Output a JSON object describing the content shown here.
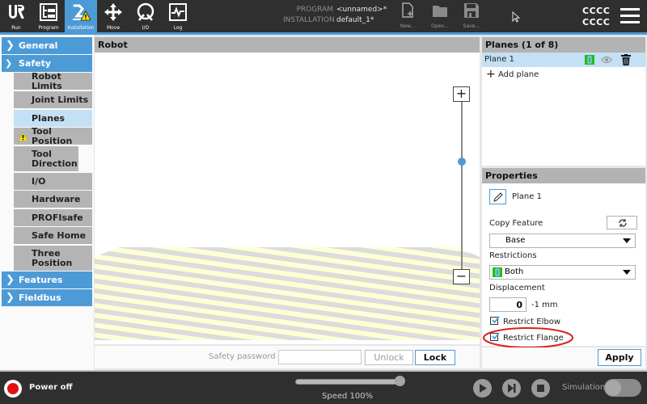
{
  "topbar": {
    "tabs": [
      {
        "id": "run",
        "label": "Run",
        "icon": "ur-logo-icon",
        "active": false
      },
      {
        "id": "program",
        "label": "Program",
        "icon": "program-tree-icon",
        "active": false
      },
      {
        "id": "installation",
        "label": "Installation",
        "icon": "robot-arm-warning-icon",
        "active": true
      },
      {
        "id": "move",
        "label": "Move",
        "icon": "move-arrows-icon",
        "active": false
      },
      {
        "id": "io",
        "label": "I/O",
        "icon": "io-gauge-icon",
        "active": false
      },
      {
        "id": "log",
        "label": "Log",
        "icon": "log-waveform-icon",
        "active": false
      }
    ],
    "program_key": "PROGRAM",
    "program_value": "<unnamed>*",
    "installation_key": "INSTALLATION",
    "installation_value": "default_1*",
    "file_buttons": [
      {
        "id": "new",
        "label": "New...",
        "icon": "new-file-icon"
      },
      {
        "id": "open",
        "label": "Open...",
        "icon": "folder-icon"
      },
      {
        "id": "save",
        "label": "Save...",
        "icon": "floppy-disk-icon"
      }
    ],
    "status_line1": "CCCC",
    "status_line2": "CCCC",
    "accent_color": "#4d9bd6"
  },
  "sidebar": {
    "groups": [
      {
        "label": "General",
        "expanded": false
      },
      {
        "label": "Safety",
        "expanded": true
      },
      {
        "label": "Features",
        "expanded": false
      },
      {
        "label": "Fieldbus",
        "expanded": false
      }
    ],
    "safety_items": [
      {
        "label": "Robot Limits",
        "selected": false,
        "warning": false
      },
      {
        "label": "Joint Limits",
        "selected": false,
        "warning": false
      },
      {
        "label": "Planes",
        "selected": true,
        "warning": false
      },
      {
        "label": "Tool Position",
        "selected": false,
        "warning": true
      },
      {
        "label": "Tool Direction",
        "selected": false,
        "warning": false
      },
      {
        "label": "I/O",
        "selected": false,
        "warning": false
      },
      {
        "label": "Hardware",
        "selected": false,
        "warning": false
      },
      {
        "label": "PROFIsafe",
        "selected": false,
        "warning": false
      },
      {
        "label": "Safe Home",
        "selected": false,
        "warning": false
      },
      {
        "label": "Three Position",
        "selected": false,
        "warning": false
      }
    ]
  },
  "robot_view": {
    "title": "Robot",
    "zoom_in": "+",
    "zoom_out": "−",
    "zoom_level": 0.5
  },
  "password_bar": {
    "label": "Safety password",
    "value": "",
    "unlock_label": "Unlock",
    "lock_label": "Lock"
  },
  "planes": {
    "title": "Planes (1 of 8)",
    "items": [
      {
        "name": "Plane 1",
        "selected": true
      }
    ],
    "add_label": "Add plane"
  },
  "properties": {
    "title": "Properties",
    "name": "Plane 1",
    "copy_feature_label": "Copy Feature",
    "copy_feature_value": "Base",
    "restrictions_label": "Restrictions",
    "restrictions_value": "Both",
    "displacement_label": "Displacement",
    "displacement_value": "0",
    "displacement_unit": "-1 mm",
    "restrict_elbow_label": "Restrict Elbow",
    "restrict_elbow_checked": true,
    "restrict_flange_label": "Restrict Flange",
    "restrict_flange_checked": true,
    "apply_label": "Apply",
    "highlight_color": "#d9201f"
  },
  "bottombar": {
    "power_label": "Power off",
    "speed_label": "Speed 100%",
    "speed_value": 1.0,
    "simulation_label": "Simulation",
    "simulation_on": false
  }
}
